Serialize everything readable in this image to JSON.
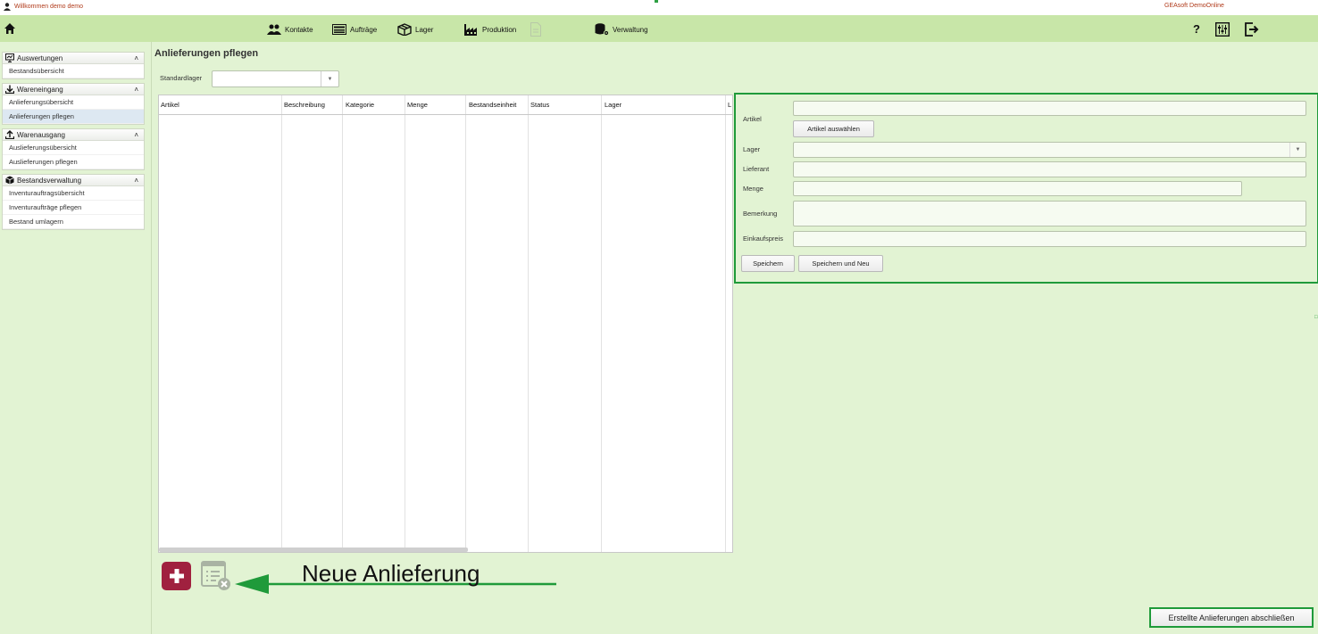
{
  "topbar": {
    "welcome": "Willkommen demo demo",
    "company": "GEAsoft DemoOnline"
  },
  "nav": {
    "items": [
      {
        "label": "Kontakte",
        "icon": "contacts-icon"
      },
      {
        "label": "Aufträge",
        "icon": "orders-icon"
      },
      {
        "label": "Lager",
        "icon": "warehouse-box-icon"
      },
      {
        "label": "Produktion",
        "icon": "factory-icon"
      },
      {
        "label": "",
        "icon": "document-icon",
        "disabled": true
      },
      {
        "label": "Verwaltung",
        "icon": "database-gear-icon"
      }
    ],
    "help": "?"
  },
  "sidebar": {
    "groups": [
      {
        "title": "Auswertungen",
        "icon": "presentation-icon",
        "items": [
          "Bestandsübersicht"
        ]
      },
      {
        "title": "Wareneingang",
        "icon": "download-icon",
        "items": [
          "Anlieferungsübersicht",
          "Anlieferungen pflegen"
        ]
      },
      {
        "title": "Warenausgang",
        "icon": "upload-icon",
        "items": [
          "Auslieferungsübersicht",
          "Auslieferungen pflegen"
        ]
      },
      {
        "title": "Bestandsverwaltung",
        "icon": "box-icon",
        "items": [
          "Inventurauftragsübersicht",
          "Inventuraufträge pflegen",
          "Bestand umlagern"
        ]
      }
    ],
    "active": "Anlieferungen pflegen"
  },
  "main": {
    "title": "Anlieferungen pflegen",
    "standardlager_label": "Standardlager",
    "standardlager_value": ""
  },
  "grid": {
    "columns": [
      "Artikel",
      "Beschreibung",
      "Kategorie",
      "Menge",
      "Bestandseinheit",
      "Status",
      "Lager",
      "L"
    ]
  },
  "form": {
    "artikel_label": "Artikel",
    "artikel_value": "",
    "artikel_button": "Artikel auswählen",
    "lager_label": "Lager",
    "lager_value": "",
    "lieferant_label": "Lieferant",
    "lieferant_value": "",
    "menge_label": "Menge",
    "menge_value": "",
    "bemerkung_label": "Bemerkung",
    "bemerkung_value": "",
    "einkaufspreis_label": "Einkaufspreis",
    "einkaufspreis_value": "",
    "save": "Speichern",
    "save_new": "Speichern und Neu"
  },
  "annotation": "Neue Anlieferung",
  "footer": {
    "close_button": "Erstellte Anlieferungen abschließen"
  },
  "colors": {
    "accent_green": "#1f9a3a",
    "add_button": "#a0213f",
    "background": "#e2f3d3",
    "navbar": "#c8e6a8"
  }
}
